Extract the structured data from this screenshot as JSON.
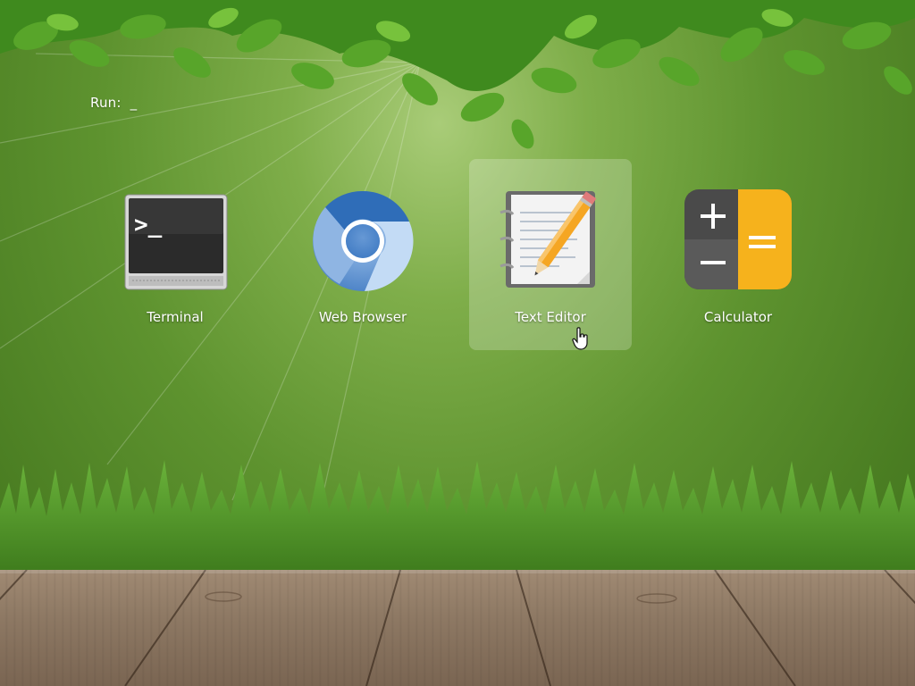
{
  "run_prompt": {
    "label": "Run:",
    "cursor": "_"
  },
  "apps": [
    {
      "label": "Terminal",
      "icon": "terminal-icon",
      "selected": false
    },
    {
      "label": "Web Browser",
      "icon": "web-browser-icon",
      "selected": false
    },
    {
      "label": "Text Editor",
      "icon": "text-editor-icon",
      "selected": true
    },
    {
      "label": "Calculator",
      "icon": "calculator-icon",
      "selected": false
    }
  ],
  "colors": {
    "background_green": "#5e932f",
    "selection_highlight": "rgba(255,255,255,0.22)",
    "calculator_accent": "#f6b21c",
    "browser_blue": "#3f7cc6"
  }
}
